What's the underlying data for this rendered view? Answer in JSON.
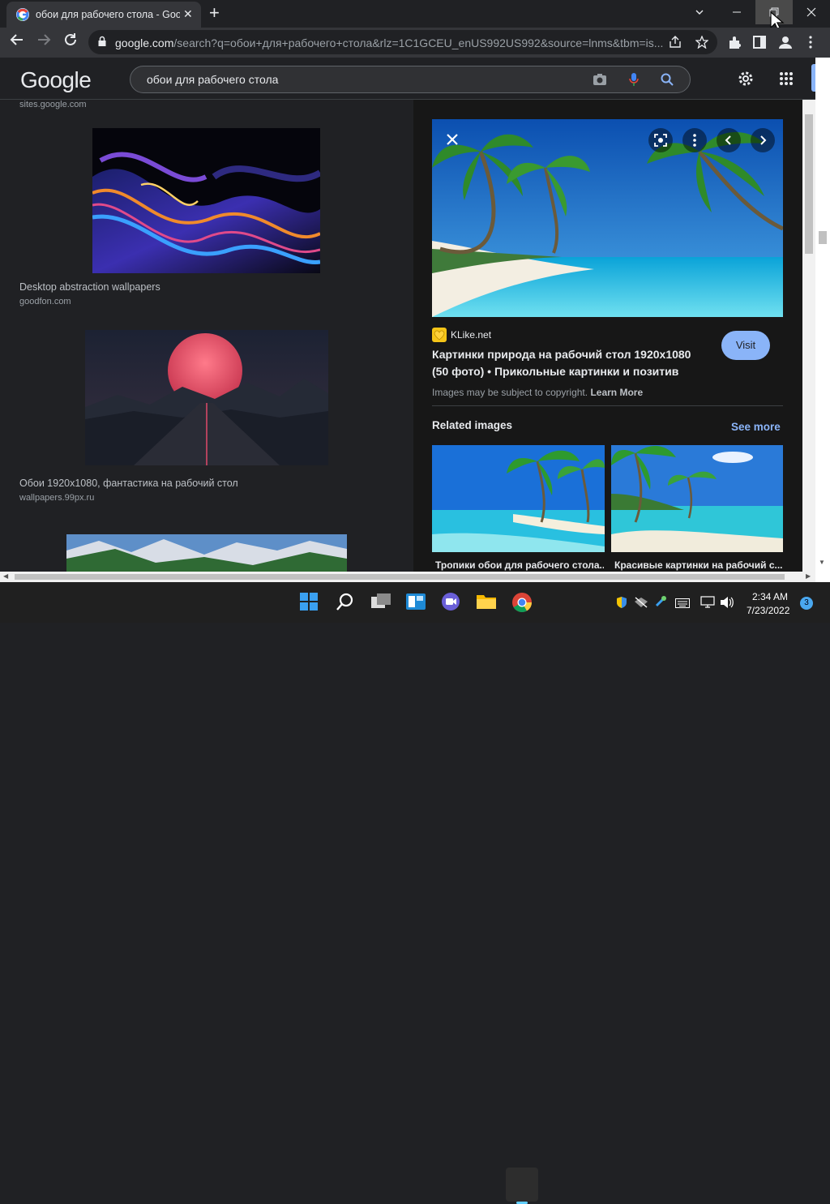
{
  "browser": {
    "tab_title": "обои для рабочего стола - Goo",
    "tab_close": "✕",
    "new_tab": "+",
    "url_host": "google.com",
    "url_path": "/search?q=обои+для+рабочего+стола&rlz=1C1GCEU_enUS992US992&source=lnms&tbm=is..."
  },
  "google": {
    "logo": "Google",
    "query": "обои для рабочего стола"
  },
  "results": [
    {
      "source_top": "sites.google.com"
    },
    {
      "title": "Desktop abstraction wallpapers",
      "source": "goodfon.com"
    },
    {
      "title": "Обои 1920x1080, фантастика на рабочий стол",
      "source": "wallpapers.99px.ru"
    }
  ],
  "preview": {
    "site": "KLike.net",
    "title": "Картинки природа на рабочий стол 1920x1080 (50 фото) • Прикольные картинки и позитив",
    "visit_label": "Visit",
    "copyright": "Images may be subject to copyright.",
    "learn_more": "Learn More",
    "related_heading": "Related images",
    "see_more": "See more",
    "related": [
      {
        "caption": "Тропики обои для рабочего стола..."
      },
      {
        "caption": "Красивые картинки на рабочий с..."
      }
    ]
  },
  "taskbar": {
    "time": "2:34 AM",
    "date": "7/23/2022",
    "notifications": "3"
  }
}
